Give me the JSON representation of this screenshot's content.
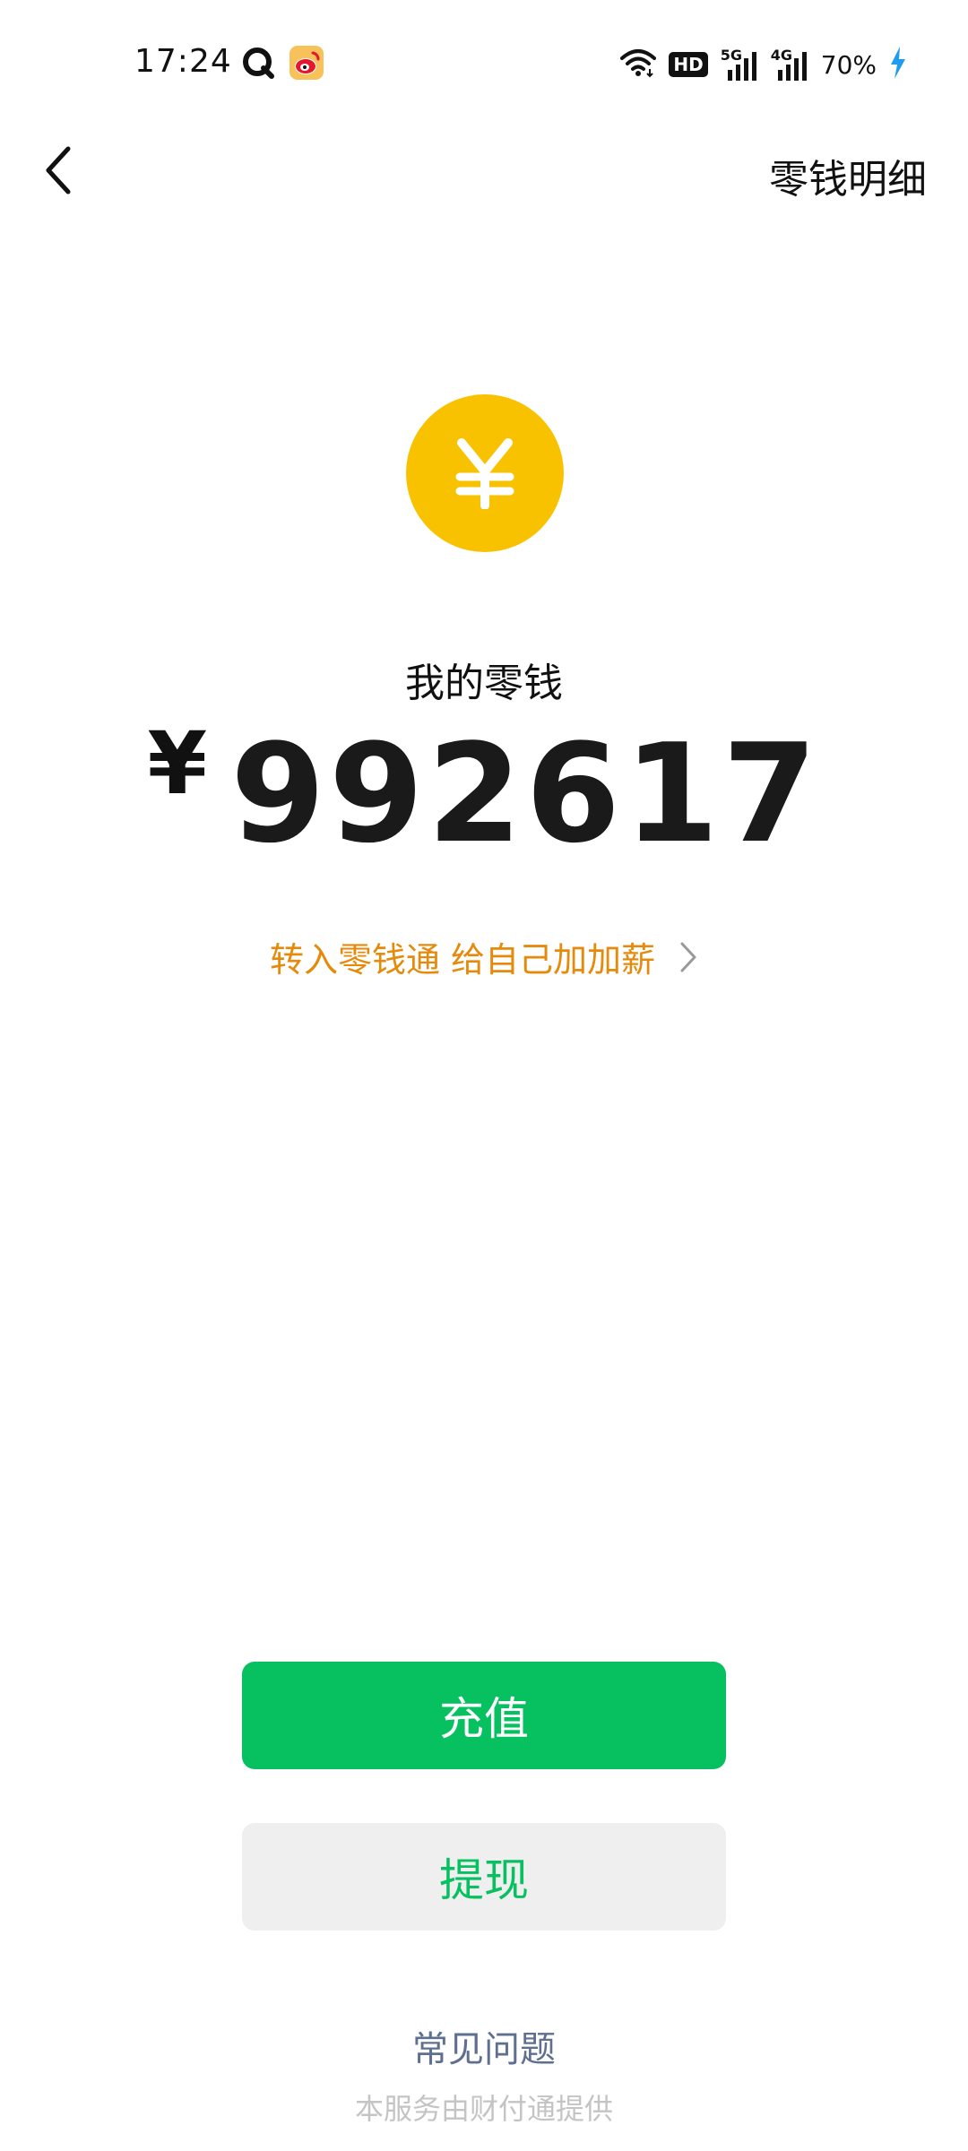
{
  "status_bar": {
    "time": "17:24",
    "battery_percent": "70%",
    "hd_label": "HD",
    "network_1": "5G",
    "network_2": "4G",
    "app_icons": [
      "qq-browser-icon",
      "weibo-icon"
    ],
    "charging_color": "#1e9cf0"
  },
  "nav": {
    "back_icon": "chevron-left-icon",
    "right_action": "零钱明细"
  },
  "balance": {
    "icon": "yuan-coin-icon",
    "icon_color": "#f9c200",
    "label": "我的零钱",
    "currency_symbol": "¥",
    "amount": "992617"
  },
  "promo": {
    "text": "转入零钱通 给自己加加薪",
    "color": "#e58a0b",
    "chevron_icon": "chevron-right-icon"
  },
  "actions": {
    "recharge_label": "充值",
    "withdraw_label": "提现",
    "primary_color": "#07c160"
  },
  "footer": {
    "faq_label": "常见问题",
    "provider_note": "本服务由财付通提供"
  }
}
